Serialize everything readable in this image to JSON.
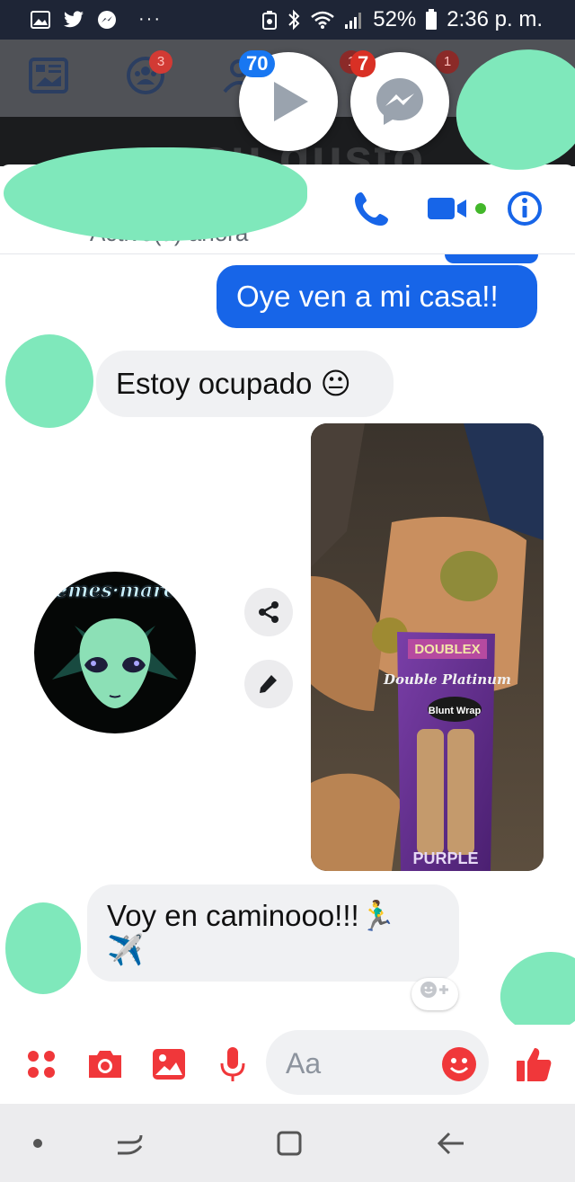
{
  "status_bar": {
    "battery": "52%",
    "time": "2:36 p. m.",
    "more": "···"
  },
  "facebook": {
    "badges": [
      "3",
      "1",
      "1"
    ],
    "behind_text": "es su gusto"
  },
  "chat_heads": {
    "video_badge": "70",
    "messenger_badge": "7"
  },
  "chat_header": {
    "status": "Activo(a) ahora"
  },
  "messages": [
    {
      "direction": "out",
      "text": "Oye ven a mi casa!!"
    },
    {
      "direction": "in",
      "text": "Estoy ocupado 😐"
    },
    {
      "direction": "out",
      "type": "image",
      "package_text": [
        "DOUBLEX",
        "Double Platinum",
        "Blunt Wrap",
        "PURPLE"
      ]
    },
    {
      "direction": "in",
      "text": "Voy en caminooo!!!🏃‍♂️",
      "text2": "✈️"
    }
  ],
  "watermark": {
    "text": "memes·marcianos"
  },
  "composer": {
    "placeholder": "Aa"
  },
  "colors": {
    "accent": "#1765e8",
    "composer_red": "#f0373a",
    "censor": "#7fe8bb"
  }
}
